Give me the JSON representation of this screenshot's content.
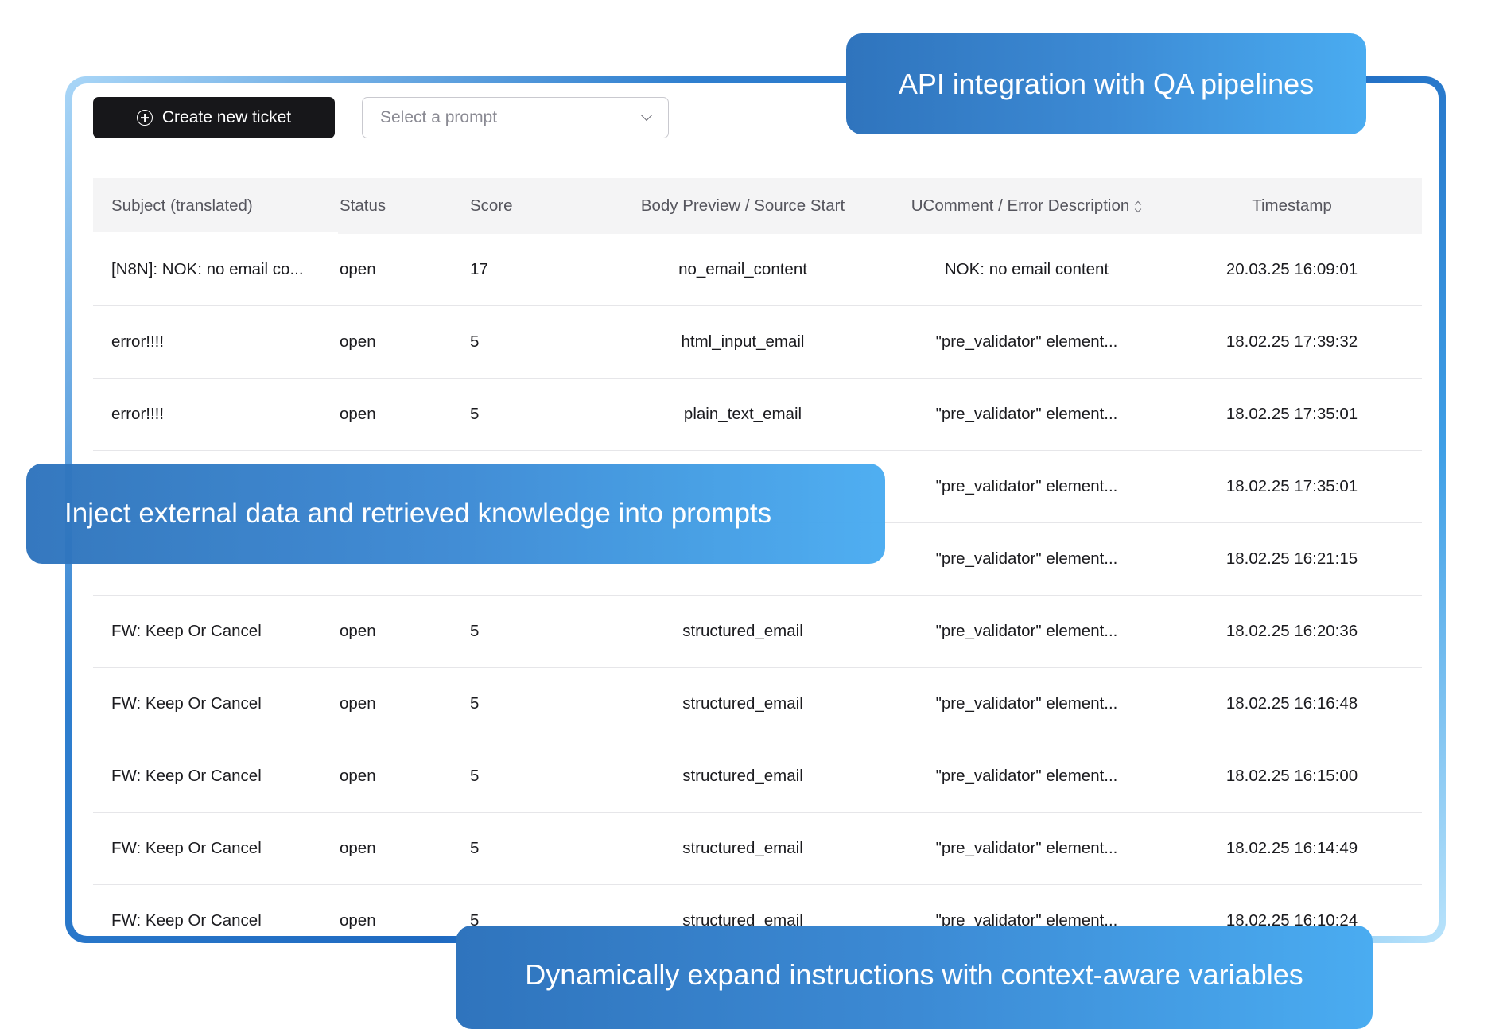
{
  "toolbar": {
    "create_label": "Create new ticket",
    "select_placeholder": "Select a prompt"
  },
  "table": {
    "columns": [
      "Subject (translated)",
      "Status",
      "Score",
      "Body Preview / Source Start",
      "UComment / Error Description",
      "Timestamp"
    ],
    "rows": [
      {
        "subject": "[N8N]: NOK: no email co...",
        "status": "open",
        "score": "17",
        "body": "no_email_content",
        "comment": "NOK: no email content",
        "timestamp": "20.03.25 16:09:01"
      },
      {
        "subject": "error!!!!",
        "status": "open",
        "score": "5",
        "body": "html_input_email",
        "comment": "\"pre_validator\" element...",
        "timestamp": "18.02.25 17:39:32"
      },
      {
        "subject": "error!!!!",
        "status": "open",
        "score": "5",
        "body": "plain_text_email",
        "comment": "\"pre_validator\" element...",
        "timestamp": "18.02.25 17:35:01"
      },
      {
        "subject": "",
        "status": "",
        "score": "",
        "body": "",
        "comment": "\"pre_validator\" element...",
        "timestamp": "18.02.25 17:35:01"
      },
      {
        "subject": "",
        "status": "",
        "score": "",
        "body": "",
        "comment": "\"pre_validator\" element...",
        "timestamp": "18.02.25 16:21:15"
      },
      {
        "subject": "FW: Keep Or Cancel",
        "status": "open",
        "score": "5",
        "body": "structured_email",
        "comment": "\"pre_validator\" element...",
        "timestamp": "18.02.25 16:20:36"
      },
      {
        "subject": "FW: Keep Or Cancel",
        "status": "open",
        "score": "5",
        "body": "structured_email",
        "comment": "\"pre_validator\" element...",
        "timestamp": "18.02.25 16:16:48"
      },
      {
        "subject": "FW: Keep Or Cancel",
        "status": "open",
        "score": "5",
        "body": "structured_email",
        "comment": "\"pre_validator\" element...",
        "timestamp": "18.02.25 16:15:00"
      },
      {
        "subject": "FW: Keep Or Cancel",
        "status": "open",
        "score": "5",
        "body": "structured_email",
        "comment": "\"pre_validator\" element...",
        "timestamp": "18.02.25 16:14:49"
      },
      {
        "subject": "FW: Keep Or Cancel",
        "status": "open",
        "score": "5",
        "body": "structured_email",
        "comment": "\"pre_validator\" element...",
        "timestamp": "18.02.25 16:10:24"
      }
    ]
  },
  "callouts": {
    "top": "API integration with QA pipelines",
    "middle": "Inject external data and retrieved knowledge into prompts",
    "bottom": "Dynamically expand instructions with context-aware variables"
  },
  "icons": {
    "create": "plus-circle-icon",
    "select": "chevron-down-icon",
    "sort": "sort-icon"
  },
  "colors": {
    "button_bg": "#17171a",
    "callout_start": "#2f74bd",
    "callout_end": "#4aacf1",
    "header_bg": "#f4f4f5"
  }
}
